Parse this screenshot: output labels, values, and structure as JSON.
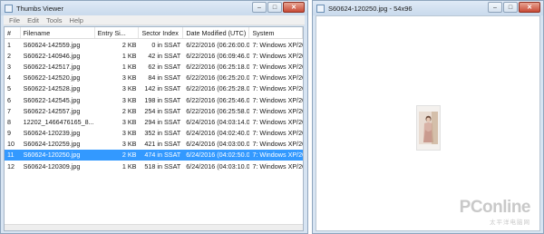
{
  "left_window": {
    "title": "Thumbs Viewer",
    "menu": [
      "File",
      "Edit",
      "Tools",
      "Help"
    ],
    "columns": [
      "#",
      "Filename",
      "Entry Si...",
      "Sector Index",
      "Date Modified (UTC)",
      "System"
    ],
    "rows": [
      {
        "n": "1",
        "file": "S60624-142559.jpg",
        "size": "2 KB",
        "sector": "0 in SSAT",
        "date": "6/22/2016 (06:26:00.0)",
        "system": "7: Windows XP/2003"
      },
      {
        "n": "2",
        "file": "S60622-140946.jpg",
        "size": "1 KB",
        "sector": "42 in SSAT",
        "date": "6/22/2016 (06:09:46.0)",
        "system": "7: Windows XP/2003"
      },
      {
        "n": "3",
        "file": "S60622-142517.jpg",
        "size": "1 KB",
        "sector": "62 in SSAT",
        "date": "6/22/2016 (06:25:18.0)",
        "system": "7: Windows XP/2003"
      },
      {
        "n": "4",
        "file": "S60622-142520.jpg",
        "size": "3 KB",
        "sector": "84 in SSAT",
        "date": "6/22/2016 (06:25:20.0)",
        "system": "7: Windows XP/2003"
      },
      {
        "n": "5",
        "file": "S60622-142528.jpg",
        "size": "3 KB",
        "sector": "142 in SSAT",
        "date": "6/22/2016 (06:25:28.0)",
        "system": "7: Windows XP/2003"
      },
      {
        "n": "6",
        "file": "S60622-142545.jpg",
        "size": "3 KB",
        "sector": "198 in SSAT",
        "date": "6/22/2016 (06:25:46.0)",
        "system": "7: Windows XP/2003"
      },
      {
        "n": "7",
        "file": "S60622-142557.jpg",
        "size": "2 KB",
        "sector": "254 in SSAT",
        "date": "6/22/2016 (06:25:58.0)",
        "system": "7: Windows XP/2003"
      },
      {
        "n": "8",
        "file": "12202_1466476165_8...",
        "size": "3 KB",
        "sector": "294 in SSAT",
        "date": "6/24/2016 (04:03:14.0)",
        "system": "7: Windows XP/2003"
      },
      {
        "n": "9",
        "file": "S60624-120239.jpg",
        "size": "3 KB",
        "sector": "352 in SSAT",
        "date": "6/24/2016 (04:02:40.0)",
        "system": "7: Windows XP/2003"
      },
      {
        "n": "10",
        "file": "S60624-120259.jpg",
        "size": "3 KB",
        "sector": "421 in SSAT",
        "date": "6/24/2016 (04:03:00.0)",
        "system": "7: Windows XP/2003"
      },
      {
        "n": "11",
        "file": "S60624-120250.jpg",
        "size": "2 KB",
        "sector": "474 in SSAT",
        "date": "6/24/2016 (04:02:50.0)",
        "system": "7: Windows XP/2003",
        "selected": true
      },
      {
        "n": "12",
        "file": "S60624-120309.jpg",
        "size": "1 KB",
        "sector": "518 in SSAT",
        "date": "6/24/2016 (04:03:10.0)",
        "system": "7: Windows XP/2003"
      }
    ]
  },
  "right_window": {
    "title": "S60624-120250.jpg - 54x96"
  },
  "caption_buttons": {
    "minimize": "–",
    "maximize": "□",
    "close": "✕"
  },
  "watermark": {
    "logo": "PConline",
    "sub": "太平洋电脑网"
  },
  "colors": {
    "selection": "#3399ff",
    "frame": "#d7e4f2",
    "close": "#c84a36"
  }
}
